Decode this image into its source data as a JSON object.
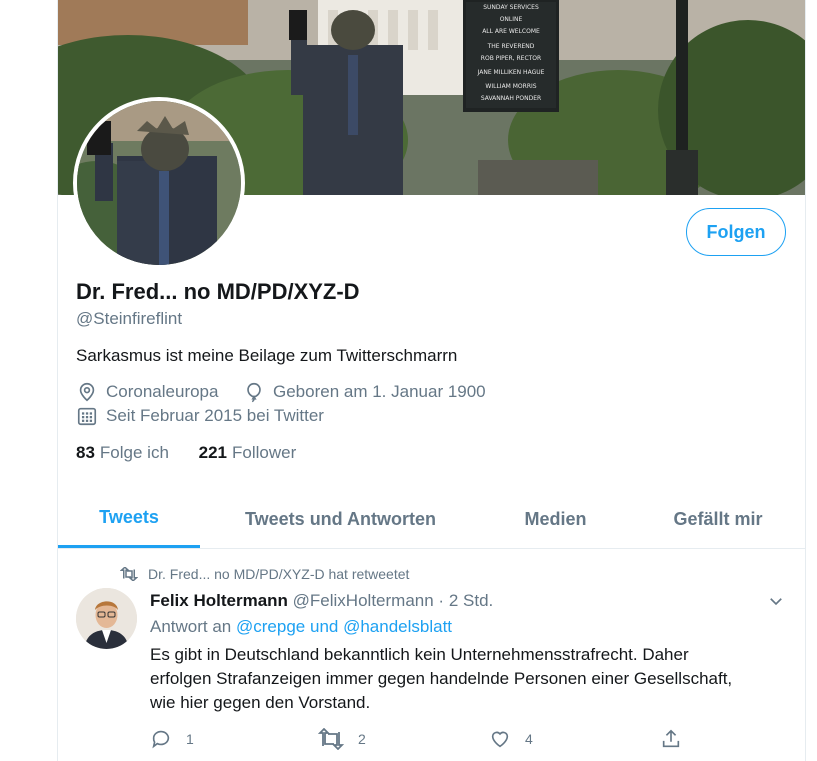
{
  "profile": {
    "display_name": "Dr. Fred... no MD/PD/XYZ-D",
    "handle": "@Steinfireflint",
    "bio": "Sarkasmus ist meine Beilage zum Twitterschmarrn",
    "location": "Coronaleuropa",
    "birthday": "Geboren am 1. Januar 1900",
    "joined": "Seit Februar 2015 bei Twitter",
    "following_count": "83",
    "following_label": "Folge ich",
    "followers_count": "221",
    "followers_label": "Follower",
    "follow_button": "Folgen"
  },
  "banner_sign": {
    "lines": [
      "SUNDAY SERVICES",
      "ONLINE",
      "ALL ARE WELCOME",
      "THE REVEREND",
      "ROB PIPER, RECTOR",
      "JANE MILLIKEN HAGUE",
      "WILLIAM MORRIS",
      "SAVANNAH PONDER"
    ]
  },
  "tabs": [
    {
      "label": "Tweets",
      "active": true
    },
    {
      "label": "Tweets und Antworten",
      "active": false
    },
    {
      "label": "Medien",
      "active": false
    },
    {
      "label": "Gefällt mir",
      "active": false
    }
  ],
  "tweet": {
    "retweeted_by": "Dr. Fred... no MD/PD/XYZ-D hat retweetet",
    "author_name": "Felix Holtermann",
    "author_handle": "@FelixHoltermann",
    "separator": "·",
    "time": "2 Std.",
    "reply_prefix": "Antwort an",
    "reply_to_1": "@crepge",
    "reply_conjunction": "und",
    "reply_to_2": "@handelsblatt",
    "text_lines": [
      "Es gibt in Deutschland bekanntlich kein Unternehmensstrafrecht. Daher",
      "erfolgen Strafanzeigen immer gegen handelnde Personen einer Gesellschaft,",
      "wie hier gegen den Vorstand."
    ],
    "reply_count": "1",
    "retweet_count": "2",
    "like_count": "4"
  },
  "icons": {
    "location": "location-pin-icon",
    "birthday": "balloon-icon",
    "joined": "calendar-icon",
    "retweet": "retweet-icon",
    "reply": "reply-icon",
    "like": "heart-icon",
    "share": "share-icon",
    "caret": "chevron-down-icon"
  },
  "colors": {
    "accent": "#1da1f2",
    "secondary_text": "#657786",
    "primary_text": "#14171a",
    "border": "#e6ecf0"
  }
}
